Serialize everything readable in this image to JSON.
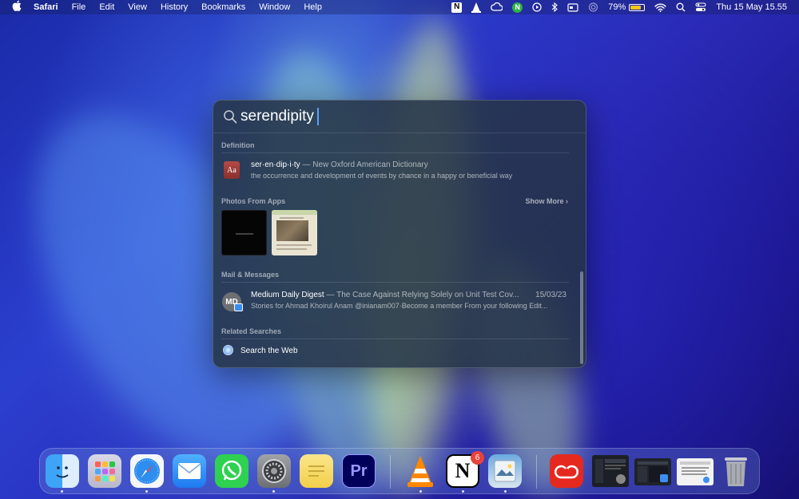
{
  "menubar": {
    "app_name": "Safari",
    "menus": [
      "File",
      "Edit",
      "View",
      "History",
      "Bookmarks",
      "Window",
      "Help"
    ],
    "status": {
      "battery_percent": "79%",
      "battery_level": 0.79,
      "datetime": "Thu 15 May  15.55",
      "notion_letter": "N",
      "n_green_letter": "N",
      "icons": [
        "notion-icon",
        "vlc-icon",
        "cloud-icon",
        "n-green-icon",
        "play-circle-icon",
        "bluetooth-icon",
        "card-icon",
        "airplay-icon",
        "battery-icon",
        "wifi-icon",
        "search-icon",
        "control-center-icon"
      ]
    }
  },
  "spotlight": {
    "query": "serendipity",
    "sections": {
      "definition": {
        "header": "Definition",
        "icon_text": "Aa",
        "word": "ser·en·dip·i·ty",
        "source": " — New Oxford American Dictionary",
        "meaning": "the occurrence and development of events by chance in a happy or beneficial way"
      },
      "photos": {
        "header": "Photos From Apps",
        "show_more": "Show More"
      },
      "mail": {
        "header": "Mail & Messages",
        "avatar": "MD",
        "sender": "Medium Daily Digest",
        "subject": " — The Case Against Relying Solely on Unit Test Cov...",
        "date": "15/03/23",
        "preview": "Stories for Ahmad Khoirul Anam @inianam007·Become a member From your following Edit..."
      },
      "related": {
        "header": "Related Searches",
        "item": "Search the Web"
      }
    }
  },
  "dock": {
    "apps": [
      {
        "name": "finder",
        "running": true
      },
      {
        "name": "launchpad",
        "running": false
      },
      {
        "name": "safari",
        "running": true
      },
      {
        "name": "mail",
        "running": false
      },
      {
        "name": "whatsapp",
        "running": false
      },
      {
        "name": "system-settings",
        "running": true
      },
      {
        "name": "stickies",
        "running": false
      },
      {
        "name": "premiere-pro",
        "label": "Pr",
        "running": false
      },
      {
        "name": "vlc",
        "running": true
      },
      {
        "name": "notion",
        "label": "N",
        "badge": "6",
        "running": true
      },
      {
        "name": "preview",
        "running": true
      },
      {
        "name": "creative-cloud",
        "running": false
      },
      {
        "name": "window-thumb-1",
        "running": false
      },
      {
        "name": "window-thumb-2",
        "running": false
      },
      {
        "name": "window-thumb-3",
        "running": false
      },
      {
        "name": "trash",
        "running": false
      }
    ]
  }
}
